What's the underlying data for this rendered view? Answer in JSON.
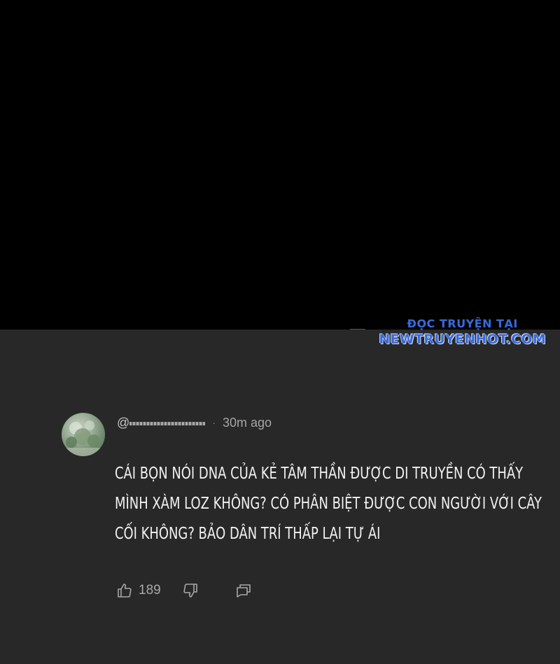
{
  "watermark": {
    "line1": "ĐỌC TRUYỆN TẠI",
    "line2": "NEWTRUYENHOT.COM"
  },
  "comment": {
    "handle": "@",
    "separator": "·",
    "time": "30m ago",
    "text": "CÁI BỌN NÓI DNA CỦA KẺ TÂM THẦN ĐƯỢC DI TRUYỀN CÓ THẤY\nMÌNH XÀM LOZ KHÔNG? CÓ PHÂN BIỆT ĐƯỢC CON NGƯỜI VỚI CÂY\nCỐI KHÔNG? BẢO DÂN TRÍ THẤP LẠI TỰ ÁI",
    "likes": "189"
  },
  "icons": {
    "like": "thumbs-up-icon",
    "dislike": "thumbs-down-icon",
    "reply": "reply-icon"
  },
  "colors": {
    "top_panel": "#000000",
    "comment_panel": "#282828",
    "watermark": "#3a6bd8",
    "text": "#f2f2f2",
    "muted": "#9a9a9a"
  }
}
